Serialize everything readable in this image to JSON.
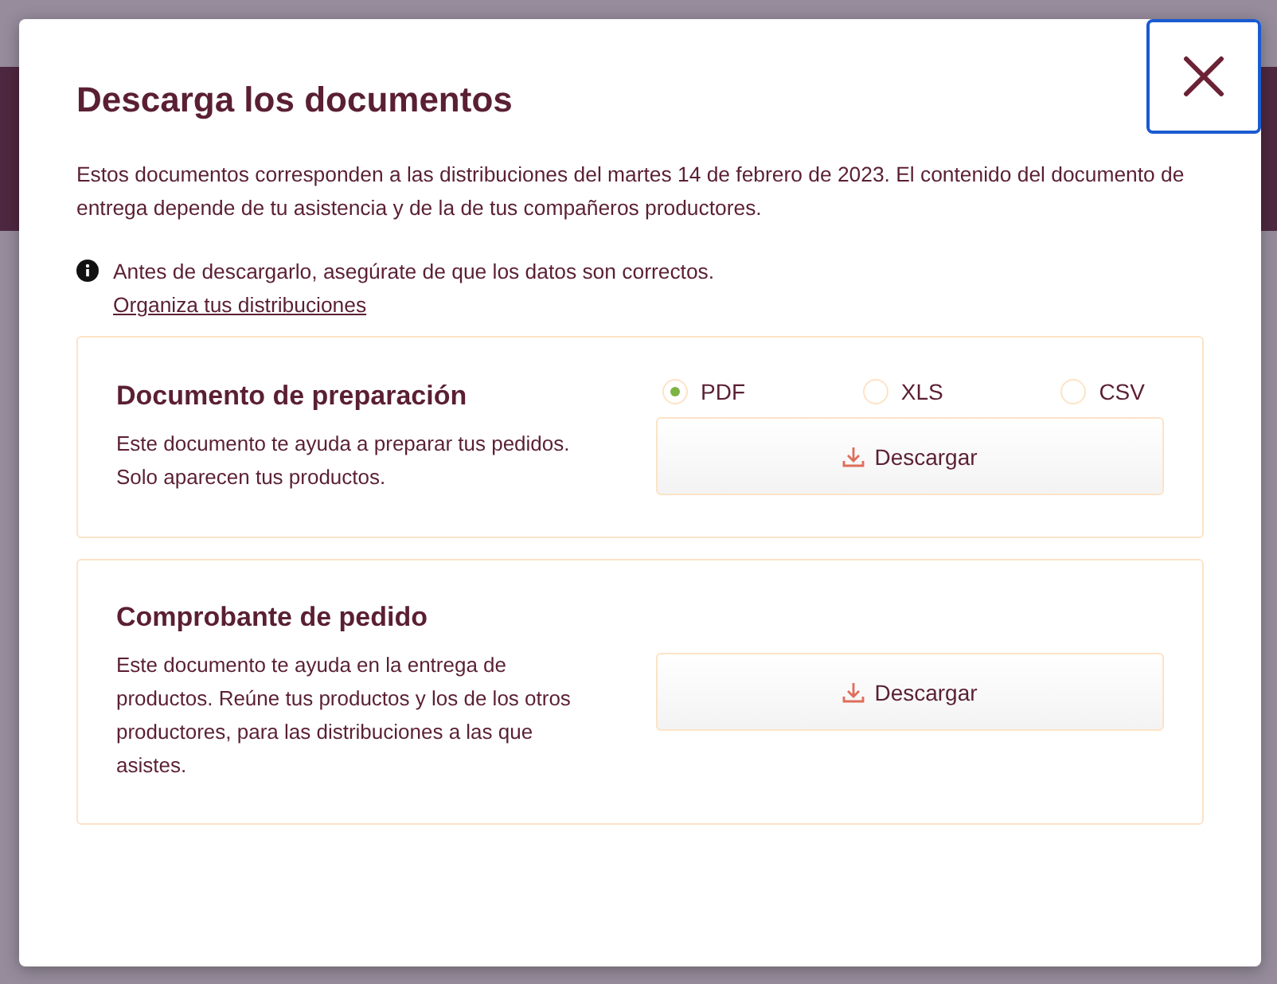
{
  "dialog": {
    "title": "Descarga los documentos",
    "intro": "Estos documentos corresponden a las distribuciones del martes 14 de febrero de 2023. El contenido del documento de entrega depende de tu asistencia y de la de tus compañeros productores.",
    "notice": "Antes de descargarlo, asegúrate de que los datos son correctos.",
    "notice_link": "Organiza tus distribuciones",
    "documents": [
      {
        "title": "Documento de preparación",
        "description": "Este documento te ayuda a preparar tus pedidos. Solo aparecen tus productos.",
        "formats": [
          {
            "label": "PDF",
            "selected": true
          },
          {
            "label": "XLS",
            "selected": false
          },
          {
            "label": "CSV",
            "selected": false
          }
        ],
        "button": "Descargar"
      },
      {
        "title": "Comprobante de pedido",
        "description": "Este documento te ayuda en la entrega de productos. Reúne tus productos y los de los otros productores, para las distribuciones a las que asistes.",
        "button": "Descargar"
      }
    ]
  }
}
